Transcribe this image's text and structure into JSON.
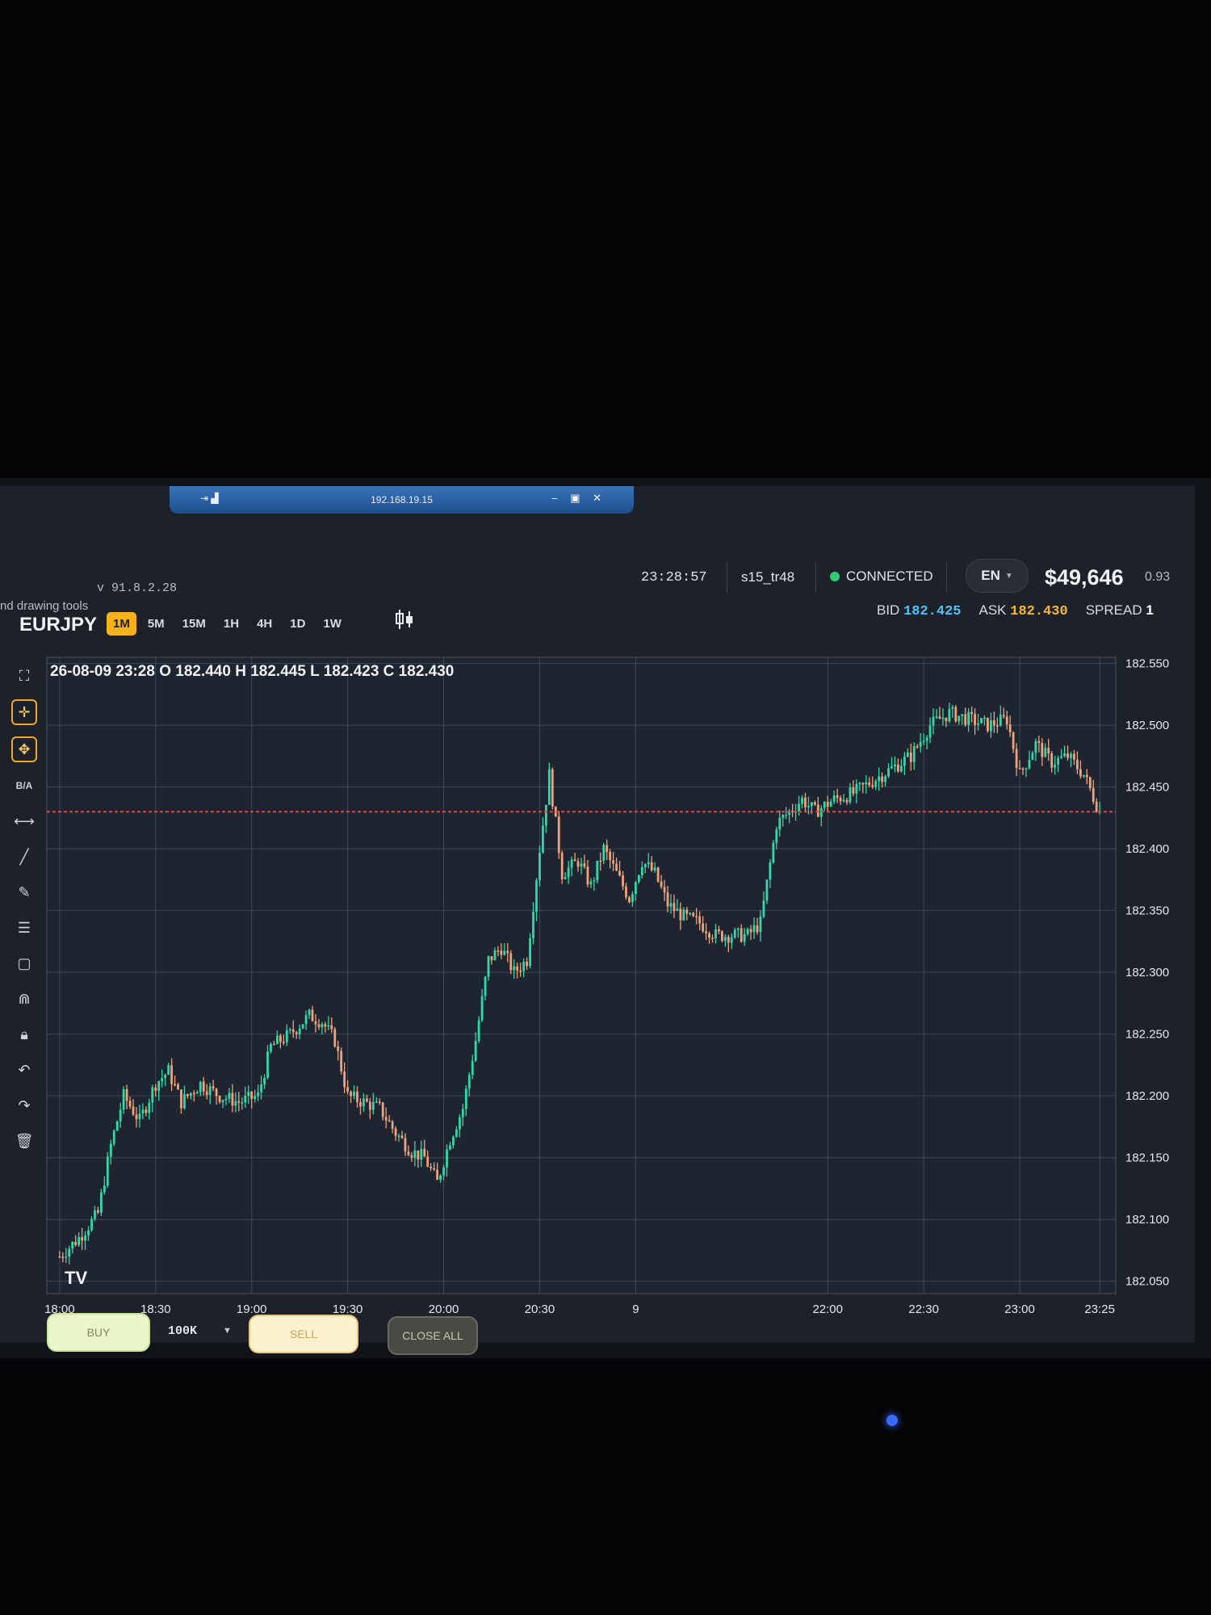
{
  "remote": {
    "host": "192.168.19.15",
    "left_icons": "⇥ ▟",
    "controls": "– ▣ ✕"
  },
  "header": {
    "drawing_hint": "nd drawing tools",
    "version": "v 91.8.2.28",
    "time": "23:28:57",
    "user": "s15_tr48",
    "status": "CONNECTED",
    "language": "EN",
    "balance": "$49,646",
    "ratio": "0.93"
  },
  "chart_header": {
    "symbol": "EURJPY",
    "timeframes": [
      "1M",
      "5M",
      "15M",
      "1H",
      "4H",
      "1D",
      "1W"
    ],
    "active_timeframe": "1M",
    "bid_label": "BID",
    "bid": "182.425",
    "ask_label": "ASK",
    "ask": "182.430",
    "spread_label": "SPREAD",
    "spread": "1"
  },
  "toolbar": {
    "ba_label": "B/A"
  },
  "trade_bar": {
    "buy_label": "BUY",
    "lot": "100K",
    "sell_label": "SELL",
    "close_all_label": "CLOSE ALL"
  },
  "colors": {
    "up": "#36d6a8",
    "down": "#f0a37a",
    "price_line": "#e0463f",
    "grid": "#5a6272",
    "accent": "#f5b21c"
  },
  "chart_data": {
    "type": "candlestick",
    "ohlc_readout": "26-08-09 23:28 O 182.440 H 182.445 L 182.423 C 182.430",
    "watermark": "TV",
    "y_ticks": [
      "182.550",
      "182.500",
      "182.450",
      "182.400",
      "182.350",
      "182.300",
      "182.250",
      "182.200",
      "182.150",
      "182.100",
      "182.050"
    ],
    "ylim": [
      182.04,
      182.555
    ],
    "x_ticks": [
      "18:00",
      "18:30",
      "19:00",
      "19:30",
      "20:00",
      "20:30",
      "9",
      "22:00",
      "22:30",
      "23:00",
      "23:25"
    ],
    "x_tick_minutes": [
      0,
      30,
      60,
      90,
      120,
      150,
      180,
      240,
      270,
      300,
      325
    ],
    "x_range_minutes": [
      -4,
      330
    ],
    "current_price": 182.43,
    "close_path": [
      [
        0,
        182.07
      ],
      [
        6,
        182.085
      ],
      [
        12,
        182.105
      ],
      [
        16,
        182.16
      ],
      [
        20,
        182.2
      ],
      [
        25,
        182.18
      ],
      [
        30,
        182.21
      ],
      [
        34,
        182.22
      ],
      [
        38,
        182.195
      ],
      [
        44,
        182.21
      ],
      [
        50,
        182.2
      ],
      [
        56,
        182.195
      ],
      [
        62,
        182.2
      ],
      [
        66,
        182.24
      ],
      [
        72,
        182.25
      ],
      [
        78,
        182.265
      ],
      [
        82,
        182.26
      ],
      [
        86,
        182.245
      ],
      [
        90,
        182.2
      ],
      [
        95,
        182.195
      ],
      [
        100,
        182.19
      ],
      [
        105,
        182.17
      ],
      [
        110,
        182.155
      ],
      [
        114,
        182.15
      ],
      [
        118,
        182.13
      ],
      [
        122,
        182.165
      ],
      [
        126,
        182.19
      ],
      [
        130,
        182.245
      ],
      [
        134,
        182.31
      ],
      [
        138,
        182.32
      ],
      [
        142,
        182.3
      ],
      [
        146,
        182.31
      ],
      [
        150,
        182.4
      ],
      [
        153,
        182.46
      ],
      [
        157,
        182.38
      ],
      [
        162,
        182.39
      ],
      [
        166,
        182.37
      ],
      [
        170,
        182.4
      ],
      [
        174,
        182.38
      ],
      [
        178,
        182.36
      ],
      [
        182,
        182.39
      ],
      [
        186,
        182.38
      ],
      [
        190,
        182.355
      ],
      [
        195,
        182.345
      ],
      [
        200,
        182.34
      ],
      [
        205,
        182.33
      ],
      [
        210,
        182.33
      ],
      [
        215,
        182.33
      ],
      [
        219,
        182.34
      ],
      [
        224,
        182.42
      ],
      [
        228,
        182.43
      ],
      [
        232,
        182.44
      ],
      [
        236,
        182.43
      ],
      [
        242,
        182.44
      ],
      [
        248,
        182.445
      ],
      [
        254,
        182.455
      ],
      [
        260,
        182.465
      ],
      [
        266,
        182.475
      ],
      [
        272,
        182.5
      ],
      [
        278,
        182.51
      ],
      [
        284,
        182.505
      ],
      [
        290,
        182.5
      ],
      [
        296,
        182.505
      ],
      [
        300,
        182.46
      ],
      [
        305,
        182.485
      ],
      [
        310,
        182.47
      ],
      [
        315,
        182.475
      ],
      [
        320,
        182.46
      ],
      [
        325,
        182.43
      ]
    ]
  }
}
